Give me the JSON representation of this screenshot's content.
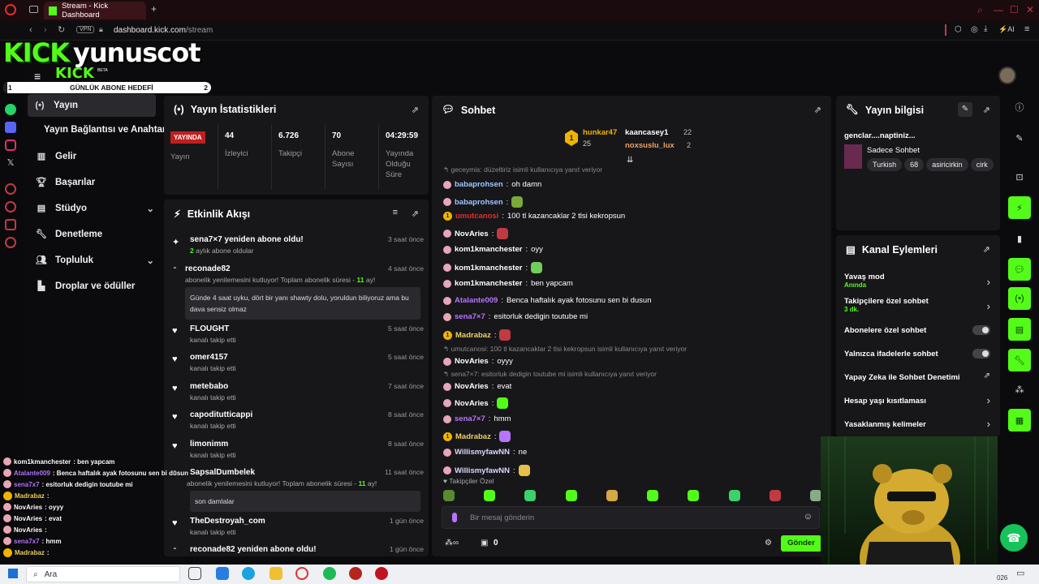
{
  "browser": {
    "tab_title": "Stream - Kick Dashboard",
    "url_host": "dashboard.kick.com",
    "url_path": "/stream",
    "vpn": "VPN",
    "ai": "AI",
    "new_tab": "+"
  },
  "header": {
    "logo": "KICK",
    "logo_sub": "KICK",
    "beta": "BETA",
    "channel": "yunuscot",
    "goal_label": "GÜNLÜK ABONE HEDEFİ",
    "goal_start": "1",
    "goal_end": "2",
    "goal_progress": 0.02
  },
  "nav": {
    "items": [
      {
        "label": "Yayın",
        "icon": "broadcast-icon"
      },
      {
        "label": "Yayın Bağlantısı ve Anahtarı"
      },
      {
        "label": "Gelir",
        "icon": "chart-icon"
      },
      {
        "label": "Başarılar",
        "icon": "trophy-icon"
      },
      {
        "label": "Stüdyo",
        "icon": "studio-icon"
      },
      {
        "label": "Denetleme",
        "icon": "wrench-icon"
      },
      {
        "label": "Topluluk",
        "icon": "people-icon"
      },
      {
        "label": "Droplar ve ödüller",
        "icon": "gift-icon"
      }
    ]
  },
  "stats": {
    "title": "Yayın İstatistikleri",
    "live_badge": "YAYINDA",
    "live_label": "Yayın",
    "items": [
      {
        "value": "44",
        "label": "İzleyici"
      },
      {
        "value": "6.726",
        "label": "Takipçi"
      },
      {
        "value": "70",
        "label": "Abone Sayısı"
      },
      {
        "value": "04:29:59",
        "label": "Yayında Olduğu Süre"
      }
    ]
  },
  "feed": {
    "title": "Etkinlik Akışı",
    "items": [
      {
        "name": "sena7×7 yeniden abone oldu!",
        "sub_num": "2",
        "sub": "aylık abone oldular",
        "time": "3 saat önce"
      },
      {
        "name": "reconade82",
        "sub": "abonelik yenilemesini kutluyor! Toplam abonelik süresi - ",
        "sub_num": "11",
        "sub_end": " ay!",
        "time": "4 saat önce",
        "quote": "Günde 4 saat uyku, dört bir yanı shawty dolu, yoruldun biliyoruz ama bu dava sensiz olmaz"
      },
      {
        "name": "FLOUGHT",
        "sub": "kanalı takip etti",
        "time": "5 saat önce"
      },
      {
        "name": "omer4157",
        "sub": "kanalı takip etti",
        "time": "5 saat önce"
      },
      {
        "name": "metebabo",
        "sub": "kanalı takip etti",
        "time": "7 saat önce"
      },
      {
        "name": "capoditutticappi",
        "sub": "kanalı takip etti",
        "time": "8 saat önce"
      },
      {
        "name": "limonimm",
        "sub": "kanalı takip etti",
        "time": "8 saat önce"
      },
      {
        "name": "SapsalDumbelek",
        "sub": "abonelik yenilemesini kutluyor! Toplam abonelik süresi - ",
        "sub_num": "11",
        "sub_end": " ay!",
        "time": "11 saat önce",
        "quote": "son damlalar"
      },
      {
        "name": "TheDestroyah_com",
        "sub": "kanalı takip etti",
        "time": "1 gün önce"
      },
      {
        "name": "reconade82 yeniden abone oldu!",
        "time": "1 gün önce"
      }
    ]
  },
  "chat": {
    "title": "Sohbet",
    "top": [
      {
        "name": "hunkar47",
        "count": "25"
      },
      {
        "name": "kaancasey1",
        "count": "22"
      },
      {
        "name": "noxsuslu_lux",
        "count": "2"
      }
    ],
    "top_rank": "1",
    "messages": [
      {
        "type": "reply",
        "text": "geceymis: düzeltiriz isimli kullanıcıya yanıt veriyor"
      },
      {
        "user": "babaprohsen",
        "color": "#9fc7ff",
        "text": "oh damn"
      },
      {
        "user": "babaprohsen",
        "color": "#9fc7ff",
        "text": ""
      },
      {
        "user": "umutcanosi",
        "color": "#e0302a",
        "text": "100 tl kazancaklar 2 tlsi kekropsun",
        "badge": "1"
      },
      {
        "user": "NovAries",
        "color": "#ffffff",
        "text": ""
      },
      {
        "user": "kom1kmanchester",
        "color": "#ffffff",
        "text": "oyy"
      },
      {
        "user": "kom1kmanchester",
        "color": "#ffffff",
        "text": ""
      },
      {
        "user": "kom1kmanchester",
        "color": "#ffffff",
        "text": "ben yapcam"
      },
      {
        "user": "Atalante009",
        "color": "#b774ff",
        "text": "Benca haftalık ayak fotosunu sen bi dusun"
      },
      {
        "user": "sena7×7",
        "color": "#b774ff",
        "text": "esitorluk dedigin toutube mi"
      },
      {
        "user": "Madrabaz",
        "color": "#f0d060",
        "text": "",
        "badge": "1"
      },
      {
        "type": "reply",
        "text": "umutcanosi: 100 tl kazancaklar 2 tlsi kekropsun isimli kullanıcıya yanıt veriyor"
      },
      {
        "user": "NovAries",
        "color": "#ffffff",
        "text": "oyyy"
      },
      {
        "type": "reply",
        "text": "sena7×7: esitorluk dedigin toutube mi isimli kullanıcıya yanıt veriyor"
      },
      {
        "user": "NovAries",
        "color": "#ffffff",
        "text": "evat"
      },
      {
        "user": "NovAries",
        "color": "#ffffff",
        "text": ""
      },
      {
        "user": "sena7×7",
        "color": "#b774ff",
        "text": "hmm"
      },
      {
        "user": "Madrabaz",
        "color": "#f0d060",
        "text": "",
        "badge": "1"
      },
      {
        "user": "WillismyfawNN",
        "color": "#d8d8ff",
        "text": "ne"
      },
      {
        "user": "WillismyfawNN",
        "color": "#d8d8ff",
        "text": ""
      }
    ],
    "followers_only": "Takipçiler Özel",
    "input_placeholder": "Bir mesaj gönderin",
    "points": "0",
    "send_label": "Gönder"
  },
  "info": {
    "title": "Yayın bilgisi",
    "stream_title": "genclar....naptiniz...",
    "category": "Sadece Sohbet",
    "tags": [
      "Turkish",
      "68",
      "asiricirkin",
      "cirk"
    ]
  },
  "actions": {
    "title": "Kanal Eylemleri",
    "items": [
      {
        "label": "Yavaş mod",
        "sub": "Anında",
        "control": "arrow"
      },
      {
        "label": "Takipçilere özel sohbet",
        "sub": "3 dk.",
        "control": "arrow"
      },
      {
        "label": "Abonelere özel sohbet",
        "control": "toggle"
      },
      {
        "label": "Yalnızca ifadelerle sohbet",
        "control": "toggle"
      },
      {
        "label": "Yapay Zeka ile Sohbet Denetimi",
        "control": "external"
      },
      {
        "label": "Hesap yaşı kısıtlaması",
        "control": "arrow"
      },
      {
        "label": "Yasaklanmış kelimeler",
        "control": "arrow"
      }
    ]
  },
  "overlay_chat": [
    {
      "user": "kom1kmanchester",
      "color": "#ffffff",
      "text": ": ben yapcam"
    },
    {
      "user": "Atalante009",
      "color": "#b774ff",
      "text": ": Benca haftalık ayak fotosunu sen bi dusun"
    },
    {
      "user": "sena7x7",
      "color": "#b774ff",
      "text": ": esitorluk dedigin toutube mi"
    },
    {
      "user": "Madrabaz",
      "color": "#f0d060",
      "text": ":"
    },
    {
      "user": "NovAries",
      "color": "#ffffff",
      "text": ": oyyy"
    },
    {
      "user": "NovAries",
      "color": "#ffffff",
      "text": ": evat"
    },
    {
      "user": "NovAries",
      "color": "#ffffff",
      "text": ":"
    },
    {
      "user": "sena7x7",
      "color": "#b774ff",
      "text": ": hmm"
    },
    {
      "user": "Madrabaz",
      "color": "#f0d060",
      "text": ":"
    }
  ],
  "taskbar": {
    "search": "Ara",
    "year": "026"
  },
  "colors": {
    "brand": "#53fc18",
    "panel": "#17171a",
    "live": "#e0302a"
  }
}
